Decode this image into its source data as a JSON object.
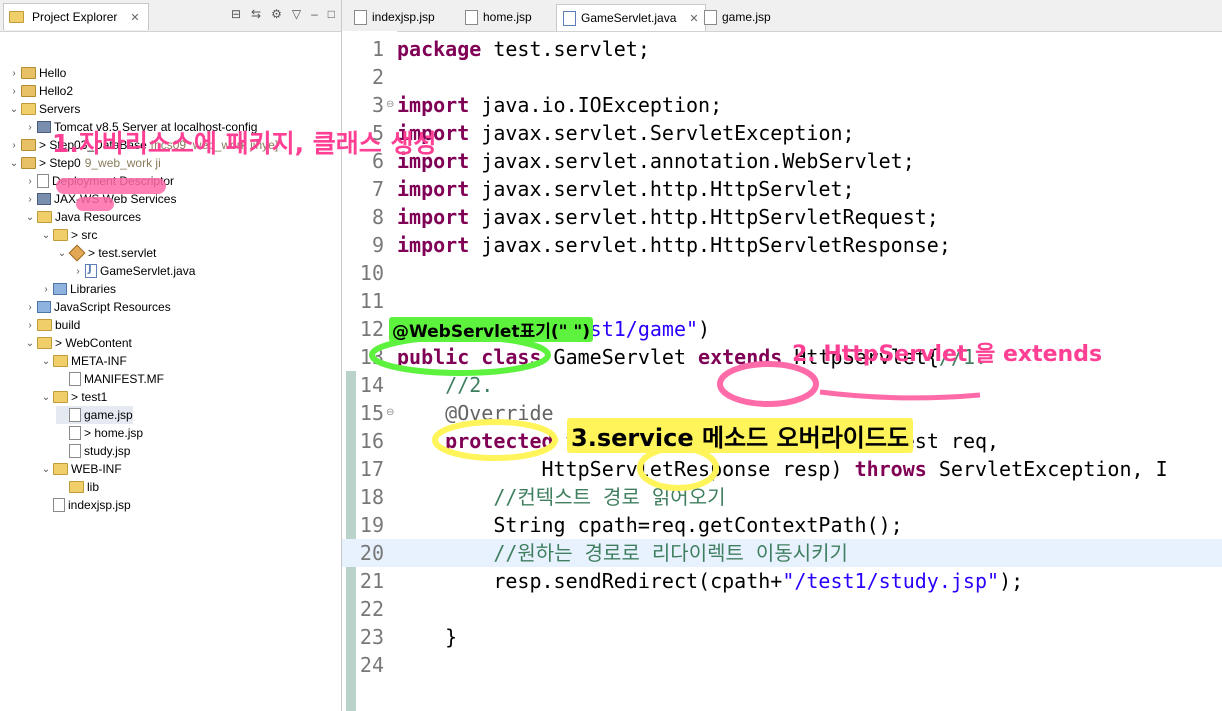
{
  "explorer": {
    "title": "Project Explorer",
    "close": "✕",
    "tree": [
      {
        "label": "Hello",
        "decoration": ""
      },
      {
        "label": "Hello2",
        "decoration": ""
      },
      {
        "label": "Servers",
        "decoration": ""
      },
      {
        "label": "Tomcat v8.5 Server at localhost-config",
        "decoration": ""
      },
      {
        "label": "> Step03_DataBase",
        "decoration": "[ncs09_web_work jihye]"
      },
      {
        "label": "> Step0",
        "decoration": "9_web_work ji"
      },
      {
        "label": "Deployment Descriptor",
        "decoration": ""
      },
      {
        "label": "JAX-WS Web Services",
        "decoration": ""
      },
      {
        "label": "Java Resources",
        "decoration": ""
      },
      {
        "label": "> src",
        "decoration": ""
      },
      {
        "label": "> test.servlet",
        "decoration": ""
      },
      {
        "label": "GameServlet.java",
        "decoration": ""
      },
      {
        "label": "Libraries",
        "decoration": ""
      },
      {
        "label": "JavaScript Resources",
        "decoration": ""
      },
      {
        "label": "build",
        "decoration": ""
      },
      {
        "label": "> WebContent",
        "decoration": ""
      },
      {
        "label": "META-INF",
        "decoration": ""
      },
      {
        "label": "MANIFEST.MF",
        "decoration": ""
      },
      {
        "label": "> test1",
        "decoration": ""
      },
      {
        "label": "game.jsp",
        "decoration": ""
      },
      {
        "label": "> home.jsp",
        "decoration": ""
      },
      {
        "label": "study.jsp",
        "decoration": ""
      },
      {
        "label": "WEB-INF",
        "decoration": ""
      },
      {
        "label": "lib",
        "decoration": ""
      },
      {
        "label": "indexjsp.jsp",
        "decoration": ""
      }
    ]
  },
  "editor": {
    "tabs": [
      {
        "label": "indexjsp.jsp"
      },
      {
        "label": "home.jsp"
      },
      {
        "label": "GameServlet.java",
        "close": "✕"
      },
      {
        "label": "game.jsp"
      }
    ],
    "lines": [
      {
        "n": "1",
        "parts": [
          [
            "kw",
            "package"
          ],
          [
            "p",
            " test.servlet;"
          ]
        ]
      },
      {
        "n": "2",
        "parts": []
      },
      {
        "n": "3",
        "parts": [
          [
            "kw",
            "import"
          ],
          [
            "p",
            " java.io.IOException;"
          ]
        ]
      },
      {
        "n": "5",
        "parts": [
          [
            "kw",
            "import"
          ],
          [
            "p",
            " javax.servlet.ServletException;"
          ]
        ]
      },
      {
        "n": "6",
        "parts": [
          [
            "kw",
            "import"
          ],
          [
            "p",
            " javax.servlet.annotation.WebServlet;"
          ]
        ]
      },
      {
        "n": "7",
        "parts": [
          [
            "kw",
            "import"
          ],
          [
            "p",
            " javax.servlet.http.HttpServlet;"
          ]
        ]
      },
      {
        "n": "8",
        "parts": [
          [
            "kw",
            "import"
          ],
          [
            "p",
            " javax.servlet.http.HttpServletRequest;"
          ]
        ]
      },
      {
        "n": "9",
        "parts": [
          [
            "kw",
            "import"
          ],
          [
            "p",
            " javax.servlet.http.HttpServletResponse;"
          ]
        ]
      },
      {
        "n": "10",
        "parts": []
      },
      {
        "n": "11",
        "parts": []
      },
      {
        "n": "12",
        "parts": [
          [
            "ann",
            "@WebServlet"
          ],
          [
            "p",
            "("
          ],
          [
            "str",
            "\"/test1/game\""
          ],
          [
            "p",
            ")"
          ]
        ]
      },
      {
        "n": "13",
        "parts": [
          [
            "kw",
            "public class"
          ],
          [
            "p",
            " GameServlet "
          ],
          [
            "kw",
            "extends"
          ],
          [
            "p",
            " HttpServlet{"
          ],
          [
            "cmt",
            "//1."
          ]
        ]
      },
      {
        "n": "14",
        "parts": [
          [
            "p",
            "    "
          ],
          [
            "cmt",
            "//2."
          ]
        ]
      },
      {
        "n": "15",
        "parts": [
          [
            "p",
            "    "
          ],
          [
            "ann",
            "@Override"
          ]
        ]
      },
      {
        "n": "16",
        "parts": [
          [
            "p",
            "    "
          ],
          [
            "kw",
            "protected void"
          ],
          [
            "p",
            " service(HttpServletRequest req,"
          ]
        ]
      },
      {
        "n": "17",
        "parts": [
          [
            "p",
            "            HttpServletResponse resp) "
          ],
          [
            "kw",
            "throws"
          ],
          [
            "p",
            " ServletException, I"
          ]
        ]
      },
      {
        "n": "18",
        "parts": [
          [
            "p",
            "        "
          ],
          [
            "cmt",
            "//컨텍스트 경로 읽어오기"
          ]
        ]
      },
      {
        "n": "19",
        "parts": [
          [
            "p",
            "        String cpath=req.getContextPath();"
          ]
        ]
      },
      {
        "n": "20",
        "parts": [
          [
            "p",
            "        "
          ],
          [
            "cmt",
            "//원하는 경로로 리다이렉트 이동시키기"
          ]
        ]
      },
      {
        "n": "21",
        "parts": [
          [
            "p",
            "        resp.sendRedirect(cpath+"
          ],
          [
            "str",
            "\"/test1/study.jsp\""
          ],
          [
            "p",
            ");"
          ]
        ]
      },
      {
        "n": "22",
        "parts": []
      },
      {
        "n": "23",
        "parts": [
          [
            "p",
            "    }"
          ]
        ]
      },
      {
        "n": "24",
        "parts": []
      }
    ]
  },
  "annotations": {
    "step1": "1.자바리소스에 패키지, 클래스 생성",
    "webservlet": "@WebServlet표기(\" \")",
    "step2": "2. HttpServlet 을 extends",
    "step3": "3.service 메소드 오버라이드도"
  },
  "colors": {
    "keyword": "#7f0055",
    "string": "#2a00ff",
    "comment": "#3f7f5f",
    "annotation": "#646464",
    "highlight_pink": "#ff3f93",
    "highlight_green": "#5cf23d",
    "highlight_yellow": "#fff45a"
  }
}
